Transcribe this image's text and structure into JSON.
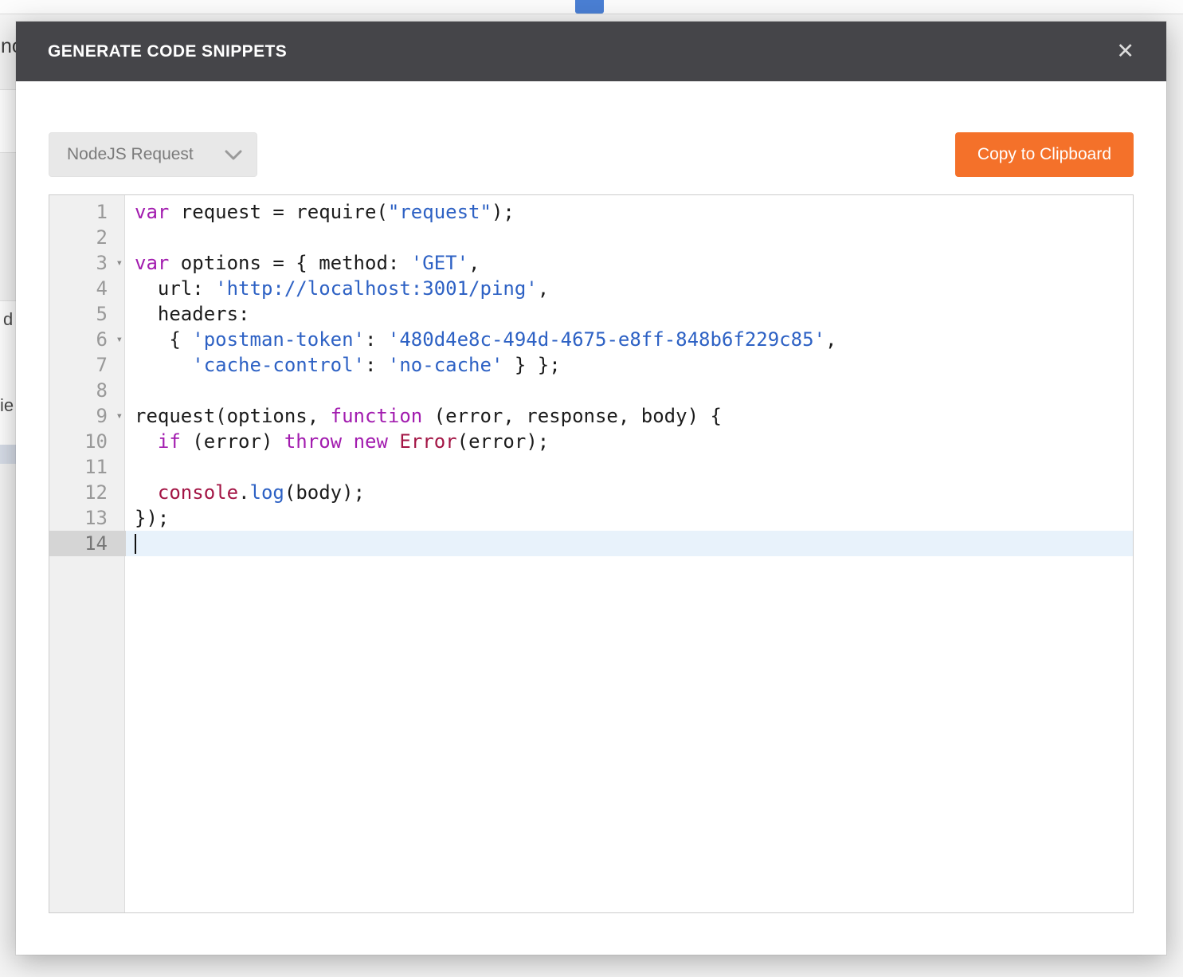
{
  "page": {
    "fragments": {
      "top_left_text": "no",
      "left_text_1": "d",
      "left_text_2": "ie"
    }
  },
  "modal": {
    "title": "GENERATE CODE SNIPPETS",
    "close_icon": "✕",
    "language_dropdown": {
      "selected": "NodeJS Request"
    },
    "copy_button": {
      "label": "Copy to Clipboard"
    },
    "colors": {
      "accent_orange": "#f4712a",
      "header_bg": "#454549",
      "keyword": "#a21caf",
      "string": "#2d61c4",
      "builtin": "#a31545",
      "active_line_bg": "#e8f2fb"
    },
    "editor": {
      "language": "javascript",
      "active_line": 14,
      "folded_lines": [
        3,
        6,
        9
      ],
      "lines": [
        {
          "num": 1,
          "tokens": [
            {
              "c": "kw",
              "t": "var"
            },
            {
              "c": "pl",
              "t": " request = require("
            },
            {
              "c": "str",
              "t": "\"request\""
            },
            {
              "c": "pl",
              "t": ");"
            }
          ]
        },
        {
          "num": 2,
          "tokens": []
        },
        {
          "num": 3,
          "tokens": [
            {
              "c": "kw",
              "t": "var"
            },
            {
              "c": "pl",
              "t": " options = { method: "
            },
            {
              "c": "str",
              "t": "'GET'"
            },
            {
              "c": "pl",
              "t": ","
            }
          ]
        },
        {
          "num": 4,
          "tokens": [
            {
              "c": "pl",
              "t": "  url: "
            },
            {
              "c": "str",
              "t": "'http://localhost:3001/ping'"
            },
            {
              "c": "pl",
              "t": ","
            }
          ]
        },
        {
          "num": 5,
          "tokens": [
            {
              "c": "pl",
              "t": "  headers: "
            }
          ]
        },
        {
          "num": 6,
          "tokens": [
            {
              "c": "pl",
              "t": "   { "
            },
            {
              "c": "str",
              "t": "'postman-token'"
            },
            {
              "c": "pl",
              "t": ": "
            },
            {
              "c": "str",
              "t": "'480d4e8c-494d-4675-e8ff-848b6f229c85'"
            },
            {
              "c": "pl",
              "t": ","
            }
          ]
        },
        {
          "num": 7,
          "tokens": [
            {
              "c": "pl",
              "t": "     "
            },
            {
              "c": "str",
              "t": "'cache-control'"
            },
            {
              "c": "pl",
              "t": ": "
            },
            {
              "c": "str",
              "t": "'no-cache'"
            },
            {
              "c": "pl",
              "t": " } };"
            }
          ]
        },
        {
          "num": 8,
          "tokens": []
        },
        {
          "num": 9,
          "tokens": [
            {
              "c": "pl",
              "t": "request(options, "
            },
            {
              "c": "kw",
              "t": "function"
            },
            {
              "c": "pl",
              "t": " (error, response, body) {"
            }
          ]
        },
        {
          "num": 10,
          "tokens": [
            {
              "c": "pl",
              "t": "  "
            },
            {
              "c": "kw",
              "t": "if"
            },
            {
              "c": "pl",
              "t": " (error) "
            },
            {
              "c": "kw",
              "t": "throw"
            },
            {
              "c": "pl",
              "t": " "
            },
            {
              "c": "kw",
              "t": "new"
            },
            {
              "c": "pl",
              "t": " "
            },
            {
              "c": "bi",
              "t": "Error"
            },
            {
              "c": "pl",
              "t": "(error);"
            }
          ]
        },
        {
          "num": 11,
          "tokens": []
        },
        {
          "num": 12,
          "tokens": [
            {
              "c": "pl",
              "t": "  "
            },
            {
              "c": "bi",
              "t": "console"
            },
            {
              "c": "pl",
              "t": "."
            },
            {
              "c": "fn",
              "t": "log"
            },
            {
              "c": "pl",
              "t": "(body);"
            }
          ]
        },
        {
          "num": 13,
          "tokens": [
            {
              "c": "pl",
              "t": "});"
            }
          ]
        },
        {
          "num": 14,
          "tokens": [],
          "cursor": true
        }
      ]
    }
  }
}
